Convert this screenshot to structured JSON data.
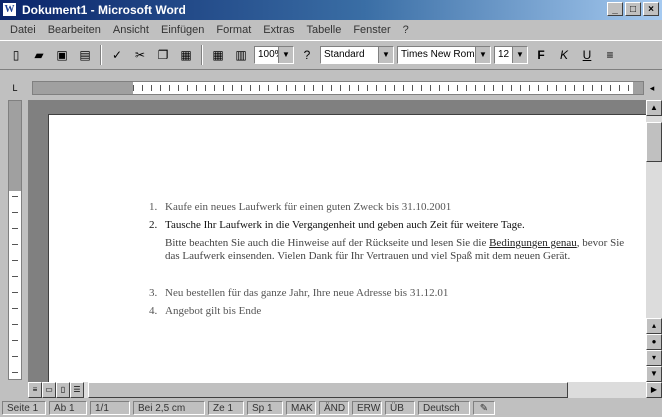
{
  "window": {
    "title": "Dokument1 - Microsoft Word",
    "app_icon": "W",
    "buttons": [
      "_",
      "□",
      "×"
    ]
  },
  "menu": [
    "Datei",
    "Bearbeiten",
    "Ansicht",
    "Einfügen",
    "Format",
    "Extras",
    "Tabelle",
    "Fenster",
    "?"
  ],
  "toolbar": {
    "zoom": "100%",
    "style": "Standard",
    "font": "Times New Roman",
    "size": "12"
  },
  "document": {
    "items": [
      {
        "num": "1.",
        "text": "Kaufe ein neues Laufwerk für einen guten Zweck bis 31.10.2001"
      },
      {
        "num": "2.",
        "text": "Tausche Ihr Laufwerk in die Vergangenheit und geben auch Zeit für weitere Tage.",
        "para": "Bitte beachten Sie auch die Hinweise auf der Rückseite und lesen Sie die",
        "para_underline": "Bedingungen genau",
        "para_tail": ", bevor Sie das Laufwerk einsenden. Vielen Dank für Ihr Vertrauen und viel Spaß mit dem neuen Gerät."
      },
      {
        "num": "3.",
        "text": "Neu bestellen für das ganze Jahr, Ihre neue Adresse bis 31.12.01"
      },
      {
        "num": "4.",
        "text": "Angebot gilt bis Ende"
      }
    ]
  },
  "status": {
    "page": "Seite 1",
    "section": "Ab 1",
    "pages": "1/1",
    "position": "Bei 2,5 cm",
    "line": "Ze 1",
    "column": "Sp 1",
    "flags": [
      "MAK",
      "ÄND",
      "ERW",
      "ÜB"
    ],
    "language": "Deutsch"
  }
}
